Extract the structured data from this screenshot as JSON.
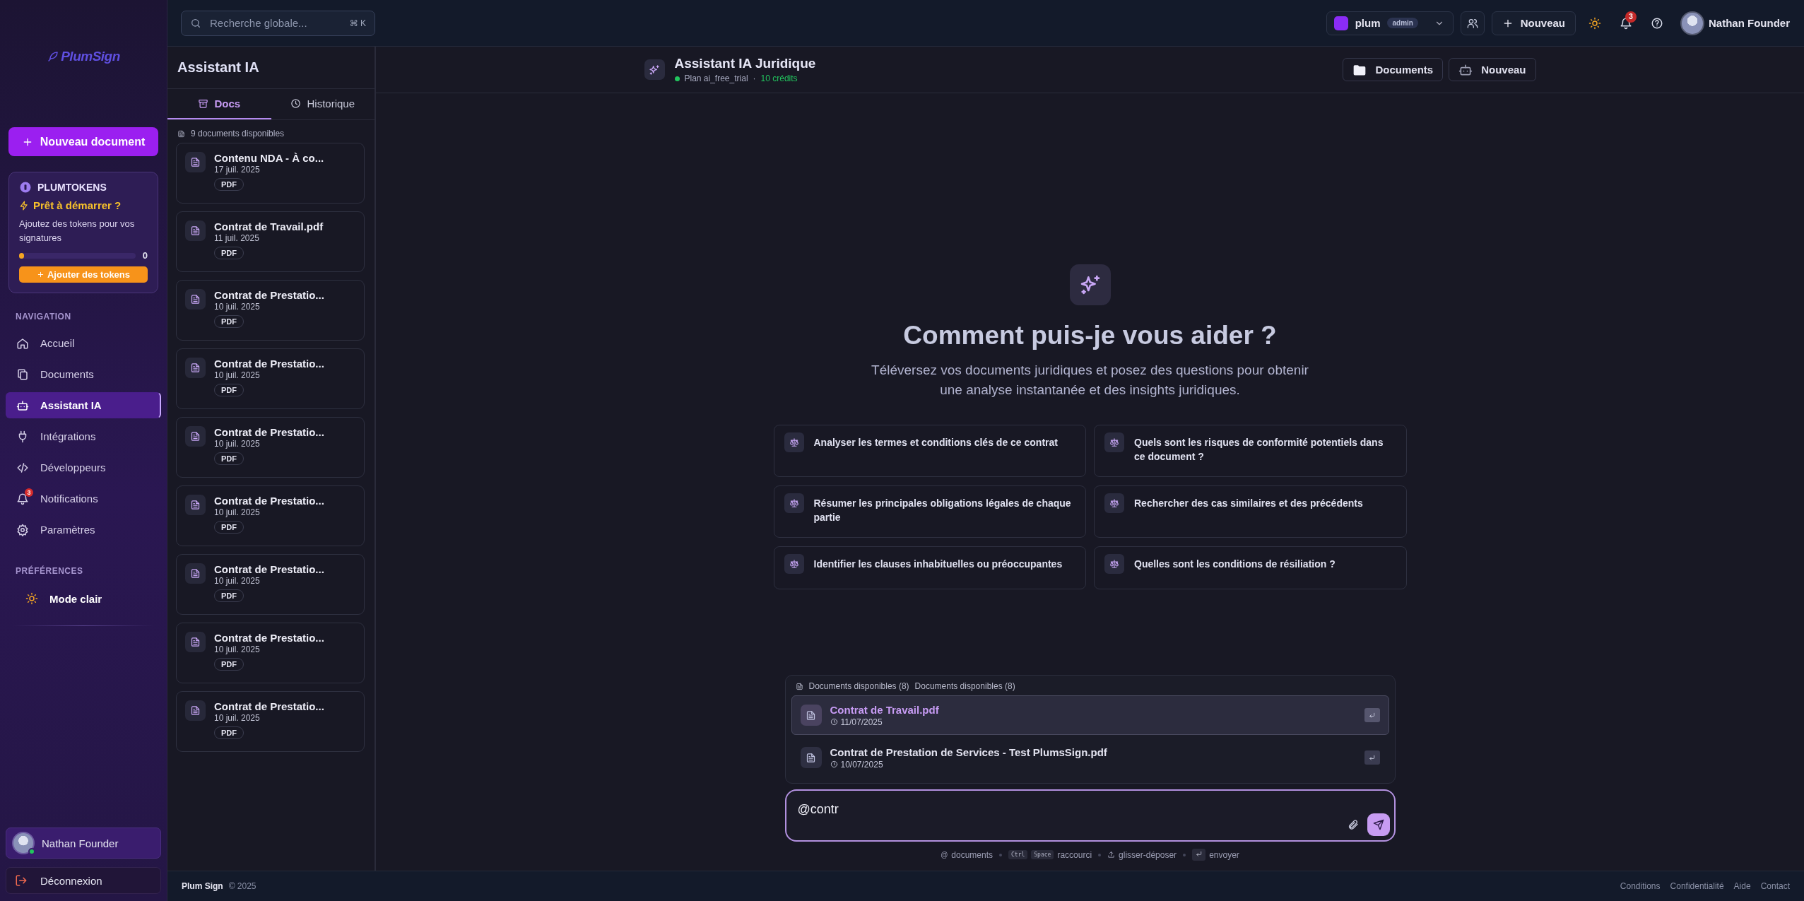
{
  "sidebar": {
    "logo": "PlumSign",
    "new_button": "Nouveau document",
    "tokens": {
      "title": "PLUMTOKENS",
      "heading": "Prêt à démarrer ?",
      "description": "Ajoutez des tokens pour vos signatures",
      "level": 0.04,
      "count": "0",
      "button": "Ajouter des tokens"
    },
    "nav_title": "NAVIGATION",
    "nav": [
      {
        "label": "Accueil",
        "kind": "home",
        "selected": false
      },
      {
        "label": "Documents",
        "kind": "copy",
        "selected": false
      },
      {
        "label": "Assistant IA",
        "kind": "bot",
        "selected": true
      },
      {
        "label": "Intégrations",
        "kind": "plug",
        "selected": false
      },
      {
        "label": "Développeurs",
        "kind": "code",
        "selected": false
      },
      {
        "label": "Notifications",
        "kind": "bell",
        "selected": false,
        "badge": "3"
      },
      {
        "label": "Paramètres",
        "kind": "gear",
        "selected": false
      }
    ],
    "prefs_title": "PRÉFÉRENCES",
    "theme_toggle": "Mode clair",
    "user": {
      "name": "Nathan Founder",
      "online": true
    },
    "logout": "Déconnexion"
  },
  "topbar": {
    "search": {
      "placeholder": "Recherche globale...",
      "shortcut": "⌘ K"
    },
    "workspace": {
      "name": "plum",
      "role": "admin"
    },
    "new_button": "Nouveau",
    "notifications_badge": "3",
    "user": "Nathan Founder"
  },
  "doc_panel": {
    "title": "Assistant IA",
    "tabs": [
      {
        "label": "Docs",
        "kind": "archive",
        "selected": true
      },
      {
        "label": "Historique",
        "kind": "clock",
        "selected": false
      }
    ],
    "count": "9 documents disponibles",
    "documents": [
      {
        "name": "Contenu NDA - À co...",
        "date": "17 juil. 2025",
        "type": "PDF"
      },
      {
        "name": "Contrat de Travail.pdf",
        "date": "11 juil. 2025",
        "type": "PDF"
      },
      {
        "name": "Contrat de Prestatio...",
        "date": "10 juil. 2025",
        "type": "PDF"
      },
      {
        "name": "Contrat de Prestatio...",
        "date": "10 juil. 2025",
        "type": "PDF"
      },
      {
        "name": "Contrat de Prestatio...",
        "date": "10 juil. 2025",
        "type": "PDF"
      },
      {
        "name": "Contrat de Prestatio...",
        "date": "10 juil. 2025",
        "type": "PDF"
      },
      {
        "name": "Contrat de Prestatio...",
        "date": "10 juil. 2025",
        "type": "PDF"
      },
      {
        "name": "Contrat de Prestatio...",
        "date": "10 juil. 2025",
        "type": "PDF"
      },
      {
        "name": "Contrat de Prestatio...",
        "date": "10 juil. 2025",
        "type": "PDF"
      }
    ]
  },
  "main": {
    "title": "Assistant IA Juridique",
    "plan": "Plan ai_free_trial",
    "separator": "·",
    "credits": "10 crédits",
    "buttons": [
      {
        "label": "Documents",
        "kind": "folder"
      },
      {
        "label": "Nouveau",
        "kind": "bot"
      }
    ],
    "hero": {
      "title": "Comment puis-je vous aider ?",
      "subtitle": "Téléversez vos documents juridiques et posez des questions pour obtenir une analyse instantanée et des insights juridiques."
    },
    "suggestions": [
      "Analyser les termes et conditions clés de ce contrat",
      "Quels sont les risques de conformité potentiels dans ce document ?",
      "Résumer les principales obligations légales de chaque partie",
      "Rechercher des cas similaires et des précédents",
      "Identifier les clauses inhabituelles ou préoccupantes",
      "Quelles sont les conditions de résiliation ?"
    ],
    "mentions": {
      "headers": [
        "Documents disponibles (8)",
        "Documents disponibles (8)"
      ],
      "items": [
        {
          "name": "Contrat de Travail.pdf",
          "date": "11/07/2025",
          "selected": true
        },
        {
          "name": "Contrat de Prestation de Services - Test PlumsSign.pdf",
          "date": "10/07/2025",
          "selected": false
        }
      ]
    },
    "input": {
      "value": "@contr"
    },
    "hints": [
      {
        "kind": "symbol",
        "keys": [
          "@"
        ],
        "label": "documents"
      },
      {
        "kind": "keys",
        "keys": [
          "Ctrl",
          "Space"
        ],
        "label": "raccourci"
      },
      {
        "kind": "upload",
        "label": "glisser-déposer"
      },
      {
        "kind": "enter",
        "label": "envoyer"
      }
    ]
  },
  "footer": {
    "brand": "Plum Sign",
    "copyright": "© 2025",
    "links": [
      "Conditions",
      "Confidentialité",
      "Aide",
      "Contact"
    ]
  }
}
